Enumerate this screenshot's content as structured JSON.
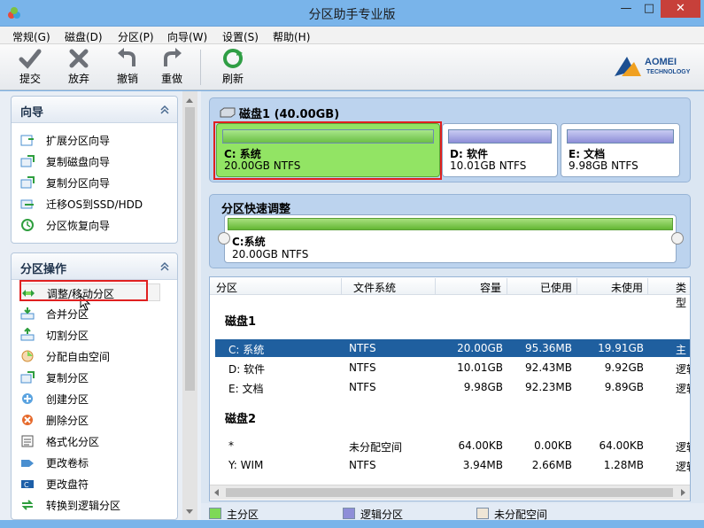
{
  "window": {
    "title": "分区助手专业版",
    "min": "—",
    "max": "□",
    "close": "✕"
  },
  "menu": [
    "常规(G)",
    "磁盘(D)",
    "分区(P)",
    "向导(W)",
    "设置(S)",
    "帮助(H)"
  ],
  "toolbar": {
    "commit": "提交",
    "discard": "放弃",
    "undo": "撤销",
    "redo": "重做",
    "refresh": "刷新"
  },
  "logo": {
    "name": "AOMEI",
    "sub": "TECHNOLOGY"
  },
  "wizard_panel": {
    "title": "向导",
    "items": [
      "扩展分区向导",
      "复制磁盘向导",
      "复制分区向导",
      "迁移OS到SSD/HDD",
      "分区恢复向导"
    ]
  },
  "ops_panel": {
    "title": "分区操作",
    "items": [
      "调整/移动分区",
      "合并分区",
      "切割分区",
      "分配自由空间",
      "复制分区",
      "创建分区",
      "删除分区",
      "格式化分区",
      "更改卷标",
      "更改盘符",
      "转换到逻辑分区"
    ]
  },
  "disk1": {
    "title": "磁盘1 (40.00GB)",
    "partitions": [
      {
        "name": "C: 系统",
        "size": "20.00GB NTFS"
      },
      {
        "name": "D: 软件",
        "size": "10.01GB NTFS"
      },
      {
        "name": "E: 文档",
        "size": "9.98GB NTFS"
      }
    ]
  },
  "quick": {
    "title": "分区快速调整",
    "name": "C:系统",
    "size": "20.00GB NTFS"
  },
  "table": {
    "headers": [
      "分区",
      "文件系统",
      "容量",
      "已使用",
      "未使用",
      "类型"
    ],
    "group1": "磁盘1",
    "group2": "磁盘2",
    "rows1": [
      [
        "C: 系统",
        "NTFS",
        "20.00GB",
        "95.36MB",
        "19.91GB",
        "主"
      ],
      [
        "D: 软件",
        "NTFS",
        "10.01GB",
        "92.43MB",
        "9.92GB",
        "逻辑"
      ],
      [
        "E: 文档",
        "NTFS",
        "9.98GB",
        "92.23MB",
        "9.89GB",
        "逻辑"
      ]
    ],
    "rows2": [
      [
        "*",
        "未分配空间",
        "64.00KB",
        "0.00KB",
        "64.00KB",
        "逻辑"
      ],
      [
        "Y: WIM",
        "NTFS",
        "3.94MB",
        "2.66MB",
        "1.28MB",
        "逻辑"
      ]
    ]
  },
  "legend": {
    "primary": "主分区",
    "logical": "逻辑分区",
    "unallocated": "未分配空间"
  },
  "colors": {
    "primary": "#7ed957",
    "logical": "#8e8ed8",
    "unallocated": "#efe6d6",
    "selection": "#1f5f9f",
    "highlight": "#e02020"
  }
}
